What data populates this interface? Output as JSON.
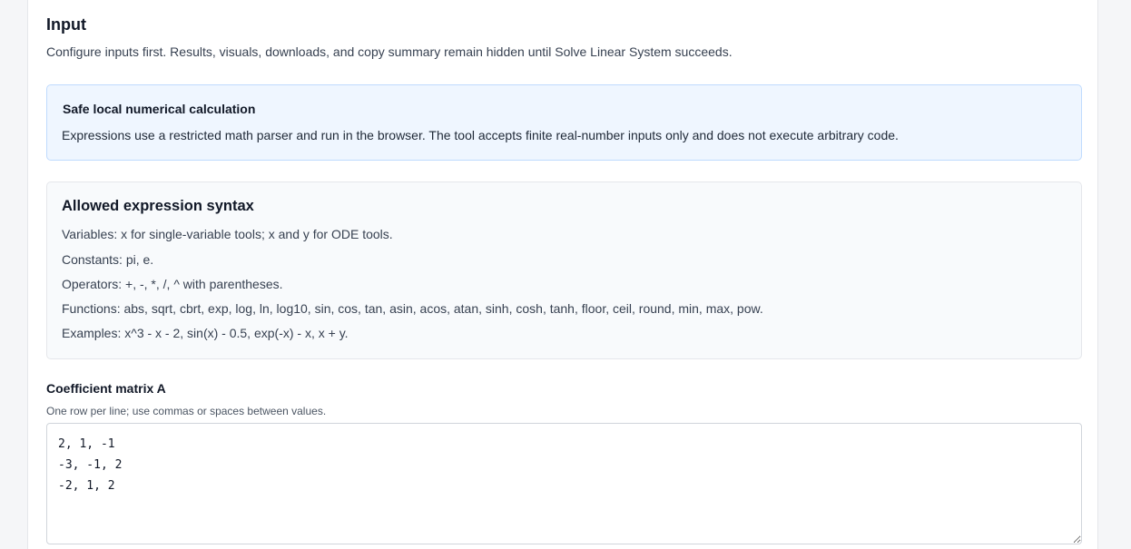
{
  "input_section": {
    "title": "Input",
    "description": "Configure inputs first. Results, visuals, downloads, and copy summary remain hidden until Solve Linear System succeeds."
  },
  "safety_notice": {
    "title": "Safe local numerical calculation",
    "text": "Expressions use a restricted math parser and run in the browser. The tool accepts finite real-number inputs only and does not execute arbitrary code."
  },
  "syntax_help": {
    "title": "Allowed expression syntax",
    "lines": [
      "Variables: x for single-variable tools; x and y for ODE tools.",
      "Constants: pi, e.",
      "Operators: +, -, *, /, ^ with parentheses.",
      "Functions: abs, sqrt, cbrt, exp, log, ln, log10, sin, cos, tan, asin, acos, atan, sinh, cosh, tanh, floor, ceil, round, min, max, pow.",
      "Examples: x^3 - x - 2, sin(x) - 0.5, exp(-x) - x, x + y."
    ]
  },
  "matrix_field": {
    "label": "Coefficient matrix A",
    "hint": "One row per line; use commas or spaces between values.",
    "value": "2, 1, -1\n-3, -1, 2\n-2, 1, 2"
  }
}
